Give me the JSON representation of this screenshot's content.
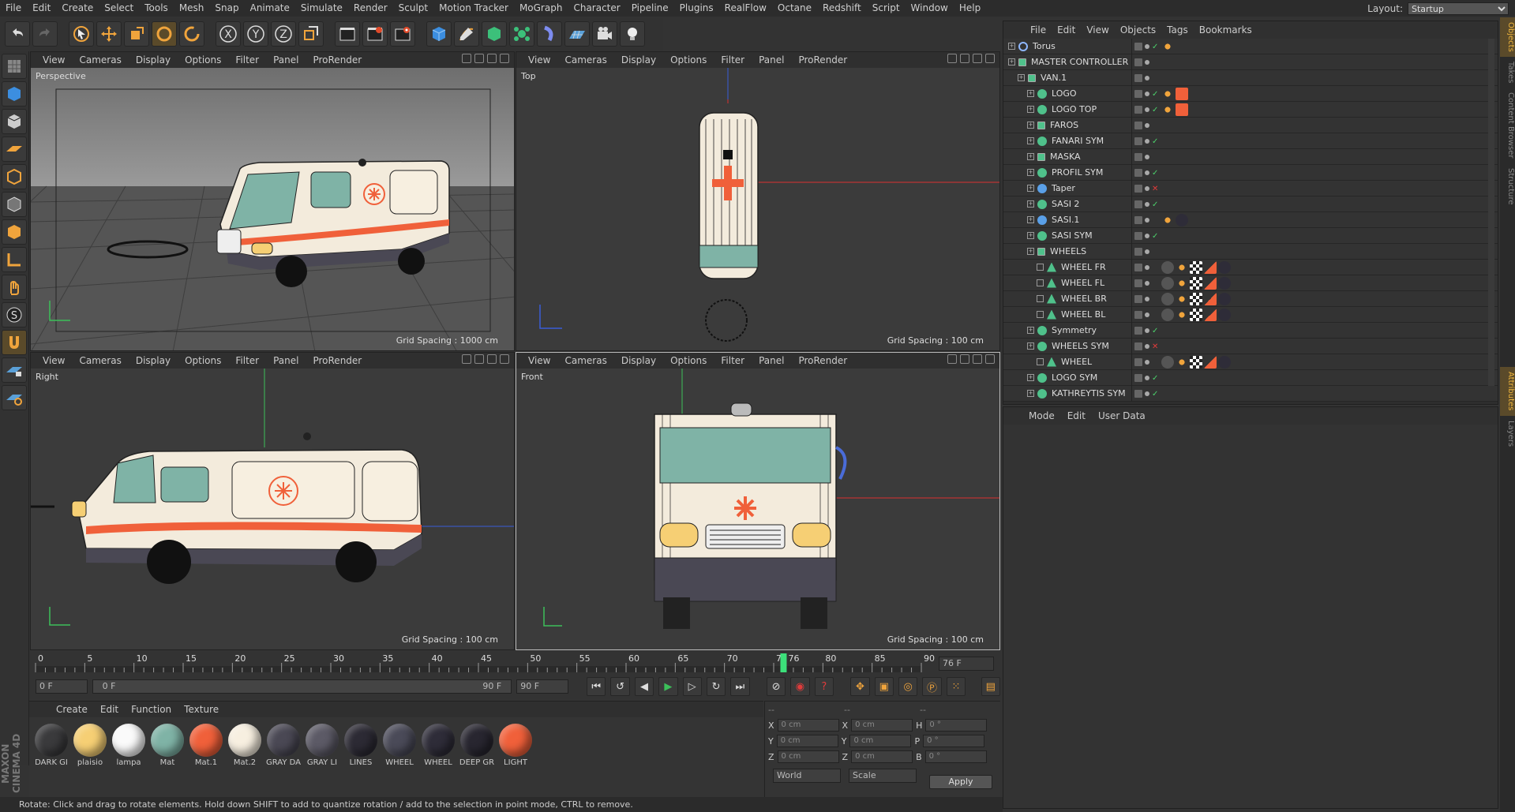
{
  "menubar": {
    "items": [
      "File",
      "Edit",
      "Create",
      "Select",
      "Tools",
      "Mesh",
      "Snap",
      "Animate",
      "Simulate",
      "Render",
      "Sculpt",
      "Motion Tracker",
      "MoGraph",
      "Character",
      "Pipeline",
      "Plugins",
      "RealFlow",
      "Octane",
      "Redshift",
      "Script",
      "Window",
      "Help"
    ],
    "layout_label": "Layout:",
    "layout_value": "Startup"
  },
  "toolbar_icons": [
    "undo-icon",
    "redo-icon",
    "select-cursor-icon",
    "move-icon",
    "scale-icon",
    "rotate-icon",
    "recent-tool-icon",
    "x-axis-icon",
    "y-axis-icon",
    "z-axis-icon",
    "coordinate-system-icon",
    "render-view-icon",
    "render-picture-viewer-icon",
    "render-settings-icon",
    "cube-object-icon",
    "pen-spline-icon",
    "subdivision-icon",
    "array-mograph-icon",
    "deformer-icon",
    "floor-icon",
    "camera-icon",
    "light-icon"
  ],
  "toolbar_axes": [
    "X",
    "Y",
    "Z"
  ],
  "viewport_menu": [
    "View",
    "Cameras",
    "Display",
    "Options",
    "Filter",
    "Panel",
    "ProRender"
  ],
  "viewports": [
    {
      "name": "Perspective",
      "grid": "Grid Spacing : 1000 cm"
    },
    {
      "name": "Top",
      "grid": "Grid Spacing : 100 cm"
    },
    {
      "name": "Right",
      "grid": "Grid Spacing : 100 cm"
    },
    {
      "name": "Front",
      "grid": "Grid Spacing : 100 cm"
    }
  ],
  "timeline": {
    "ticks": [
      "0",
      "5",
      "10",
      "15",
      "20",
      "25",
      "30",
      "35",
      "40",
      "45",
      "50",
      "55",
      "60",
      "65",
      "70",
      "75",
      "80",
      "85",
      "90"
    ],
    "current_marker": "76",
    "current_frame": "76 F",
    "start_field": "0 F",
    "range_start": "0 F",
    "range_end": "90 F",
    "end_field": "90 F"
  },
  "materials": {
    "menu": [
      "Create",
      "Edit",
      "Function",
      "Texture"
    ],
    "items": [
      {
        "name": "DARK GI",
        "color": "#3a3a3c"
      },
      {
        "name": "plaisio",
        "color": "#f6cf74"
      },
      {
        "name": "lampa",
        "color": "#fafafa"
      },
      {
        "name": "Mat",
        "color": "#7fb3a6"
      },
      {
        "name": "Mat.1",
        "color": "#f0603a"
      },
      {
        "name": "Mat.2",
        "color": "#f7efe0"
      },
      {
        "name": "GRAY DA",
        "color": "#4a4854"
      },
      {
        "name": "GRAY LI",
        "color": "#5c5a66"
      },
      {
        "name": "LINES",
        "color": "#2c2a34"
      },
      {
        "name": "WHEEL",
        "color": "#4a4a58"
      },
      {
        "name": "WHEEL",
        "color": "#2e2c38"
      },
      {
        "name": "DEEP GR",
        "color": "#282630"
      },
      {
        "name": "LIGHT",
        "color": "#f0603a"
      }
    ]
  },
  "coords": {
    "headers": [
      "--",
      "--",
      "--"
    ],
    "rows": [
      {
        "l1": "X",
        "v1": "0 cm",
        "l2": "X",
        "v2": "0 cm",
        "l3": "H",
        "v3": "0 °"
      },
      {
        "l1": "Y",
        "v1": "0 cm",
        "l2": "Y",
        "v2": "0 cm",
        "l3": "P",
        "v3": "0 °"
      },
      {
        "l1": "Z",
        "v1": "0 cm",
        "l2": "Z",
        "v2": "0 cm",
        "l3": "B",
        "v3": "0 °"
      }
    ],
    "world": "World",
    "scale": "Scale",
    "apply": "Apply"
  },
  "status": "Rotate: Click and drag to rotate elements. Hold down SHIFT to add to quantize rotation / add to the selection in point mode, CTRL to remove.",
  "maxon": "MAXON CINEMA 4D",
  "objects": {
    "menu": [
      "File",
      "Edit",
      "View",
      "Objects",
      "Tags",
      "Bookmarks"
    ],
    "rows": [
      {
        "name": "Torus",
        "indent": 0,
        "icon": "torus",
        "check": "ok"
      },
      {
        "name": "MASTER CONTROLLER",
        "indent": 0,
        "icon": "null",
        "check": ""
      },
      {
        "name": "VAN.1",
        "indent": 1,
        "icon": "null",
        "check": ""
      },
      {
        "name": "LOGO",
        "indent": 2,
        "icon": "green",
        "check": "ok"
      },
      {
        "name": "LOGO TOP",
        "indent": 2,
        "icon": "green",
        "check": "ok"
      },
      {
        "name": "FAROS",
        "indent": 2,
        "icon": "null",
        "check": ""
      },
      {
        "name": "FANARI SYM",
        "indent": 2,
        "icon": "green",
        "check": "ok"
      },
      {
        "name": "MASKA",
        "indent": 2,
        "icon": "null",
        "check": ""
      },
      {
        "name": "PROFIL SYM",
        "indent": 2,
        "icon": "green",
        "check": "ok"
      },
      {
        "name": "Taper",
        "indent": 2,
        "icon": "blue",
        "check": "x"
      },
      {
        "name": "SASI 2",
        "indent": 2,
        "icon": "green",
        "check": "ok"
      },
      {
        "name": "SASI.1",
        "indent": 2,
        "icon": "blue",
        "check": ""
      },
      {
        "name": "SASI SYM",
        "indent": 2,
        "icon": "green",
        "check": "ok"
      },
      {
        "name": "WHEELS",
        "indent": 2,
        "icon": "null",
        "check": ""
      },
      {
        "name": "WHEEL FR",
        "indent": 3,
        "icon": "instance",
        "check": ""
      },
      {
        "name": "WHEEL FL",
        "indent": 3,
        "icon": "instance",
        "check": ""
      },
      {
        "name": "WHEEL BR",
        "indent": 3,
        "icon": "instance",
        "check": ""
      },
      {
        "name": "WHEEL BL",
        "indent": 3,
        "icon": "instance",
        "check": ""
      },
      {
        "name": "Symmetry",
        "indent": 2,
        "icon": "green",
        "check": "ok"
      },
      {
        "name": "WHEELS SYM",
        "indent": 2,
        "icon": "green",
        "check": "x"
      },
      {
        "name": "WHEEL",
        "indent": 3,
        "icon": "instance",
        "check": ""
      },
      {
        "name": "LOGO SYM",
        "indent": 2,
        "icon": "green",
        "check": "ok"
      },
      {
        "name": "KATHREYTIS SYM",
        "indent": 2,
        "icon": "green",
        "check": "ok"
      }
    ]
  },
  "attributes": {
    "menu": [
      "Mode",
      "Edit",
      "User Data"
    ]
  },
  "side_tabs": [
    "Objects",
    "Takes",
    "Content Browser",
    "Structure",
    "Attributes",
    "Layers"
  ],
  "colors": {
    "accent_orange": "#f0a43c",
    "grid": "#4a4a4a",
    "x_axis": "#d83030",
    "y_axis": "#3cc05a",
    "z_axis": "#3a5cd8",
    "van_body": "#f7efe0",
    "van_stripe": "#f0603a",
    "van_glass": "#7fb3a6",
    "van_dark": "#2e2c38"
  }
}
